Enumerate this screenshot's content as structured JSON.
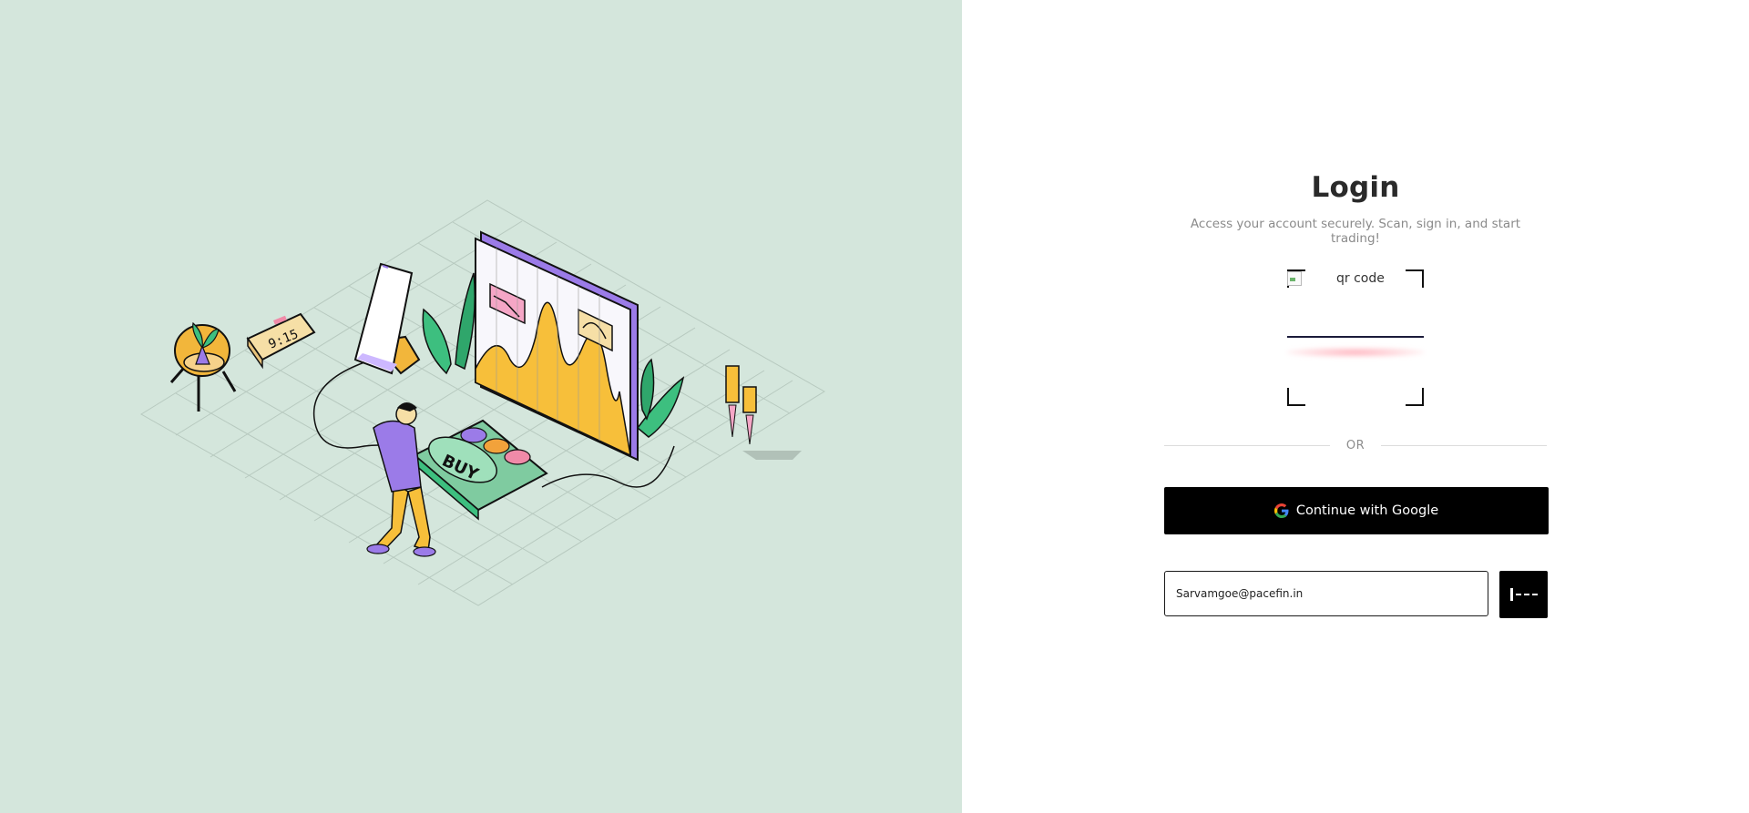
{
  "login": {
    "title": "Login",
    "subtitle": "Access your account securely. Scan, sign in, and start trading!",
    "qr_alt": "qr code",
    "divider": "OR",
    "google_button": "Continue with Google",
    "email_value": "Sarvamgoe@pacefin.in"
  },
  "illustration": {
    "clock_time": "9:15",
    "button_text": "BUY"
  },
  "colors": {
    "left_bg": "#d4e6dc",
    "accent_yellow": "#f7bf3a",
    "accent_purple": "#9b7be8",
    "accent_green": "#3dbf7f",
    "button_black": "#000000"
  }
}
